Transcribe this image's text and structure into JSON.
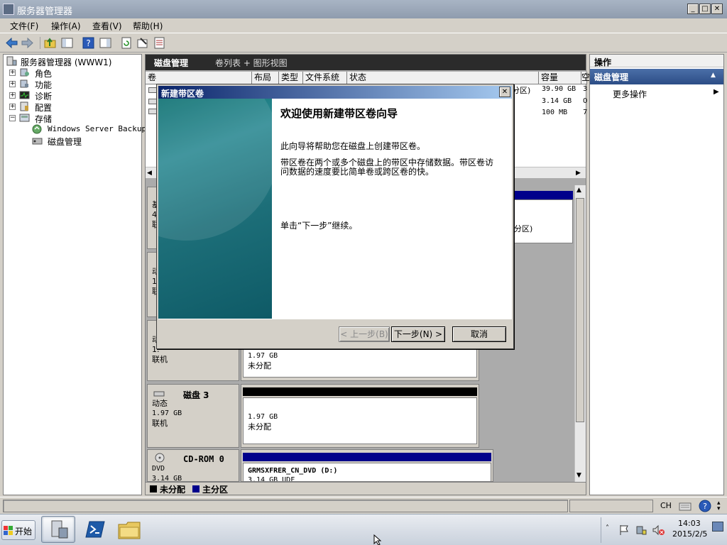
{
  "window": {
    "title": "服务器管理器"
  },
  "menu": [
    "文件(F)",
    "操作(A)",
    "查看(V)",
    "帮助(H)"
  ],
  "tree": {
    "root": "服务器管理器 (WWW1)",
    "items": [
      {
        "label": "角色",
        "expander": "+"
      },
      {
        "label": "功能",
        "expander": "+"
      },
      {
        "label": "诊断",
        "expander": "+"
      },
      {
        "label": "配置",
        "expander": "+"
      },
      {
        "label": "存储",
        "expander": "−"
      }
    ],
    "storage_children": [
      "Windows Server Backup",
      "磁盘管理"
    ]
  },
  "center": {
    "title": "磁盘管理",
    "view_tabs": "卷列表 + 图形视图",
    "columns": [
      "卷",
      "布局",
      "类型",
      "文件系统",
      "状态",
      "容量",
      "空"
    ],
    "rows": [
      {
        "status_tail": "分区)",
        "capacity": "39.90 GB",
        "free": "3"
      },
      {
        "status_tail": "",
        "capacity": "3.14 GB",
        "free": "0"
      },
      {
        "status_tail": "",
        "capacity": "100 MB",
        "free": "7"
      }
    ]
  },
  "disks": [
    {
      "left_lines": [
        "基",
        "40",
        "联"
      ],
      "right_text": "分区)"
    },
    {
      "left_lines": [
        "动",
        "1.",
        "联"
      ]
    },
    {
      "left_lines": [
        "动",
        "1.",
        "联机"
      ],
      "right_lines": [
        "1.97 GB",
        "未分配"
      ]
    },
    {
      "name": "磁盘 3",
      "left_lines": [
        "动态",
        "1.97 GB",
        "联机"
      ],
      "right_lines": [
        "1.97 GB",
        "未分配"
      ]
    },
    {
      "name": "CD-ROM 0",
      "left_lines": [
        "DVD",
        "3.14 GB"
      ],
      "right_lines": [
        "GRMSXFRER_CN_DVD  (D:)",
        "3.14 GB UDF"
      ]
    }
  ],
  "legend": [
    {
      "label": "未分配",
      "color": "#000000"
    },
    {
      "label": "主分区",
      "color": "#00008b"
    }
  ],
  "actions": {
    "title": "操作",
    "section": "磁盘管理",
    "more": "更多操作"
  },
  "dialog": {
    "title": "新建带区卷",
    "heading": "欢迎使用新建带区卷向导",
    "p1": "此向导将帮助您在磁盘上创建带区卷。",
    "p2": "带区卷在两个或多个磁盘上的带区中存储数据。带区卷访问数据的速度要比简单卷或跨区卷的快。",
    "p3": "单击“下一步”继续。",
    "back": "< 上一步(B)",
    "next": "下一步(N) >",
    "cancel": "取消"
  },
  "taskbar": {
    "start": "开始",
    "lang": "CH",
    "time": "14:03",
    "date": "2015/2/5"
  }
}
